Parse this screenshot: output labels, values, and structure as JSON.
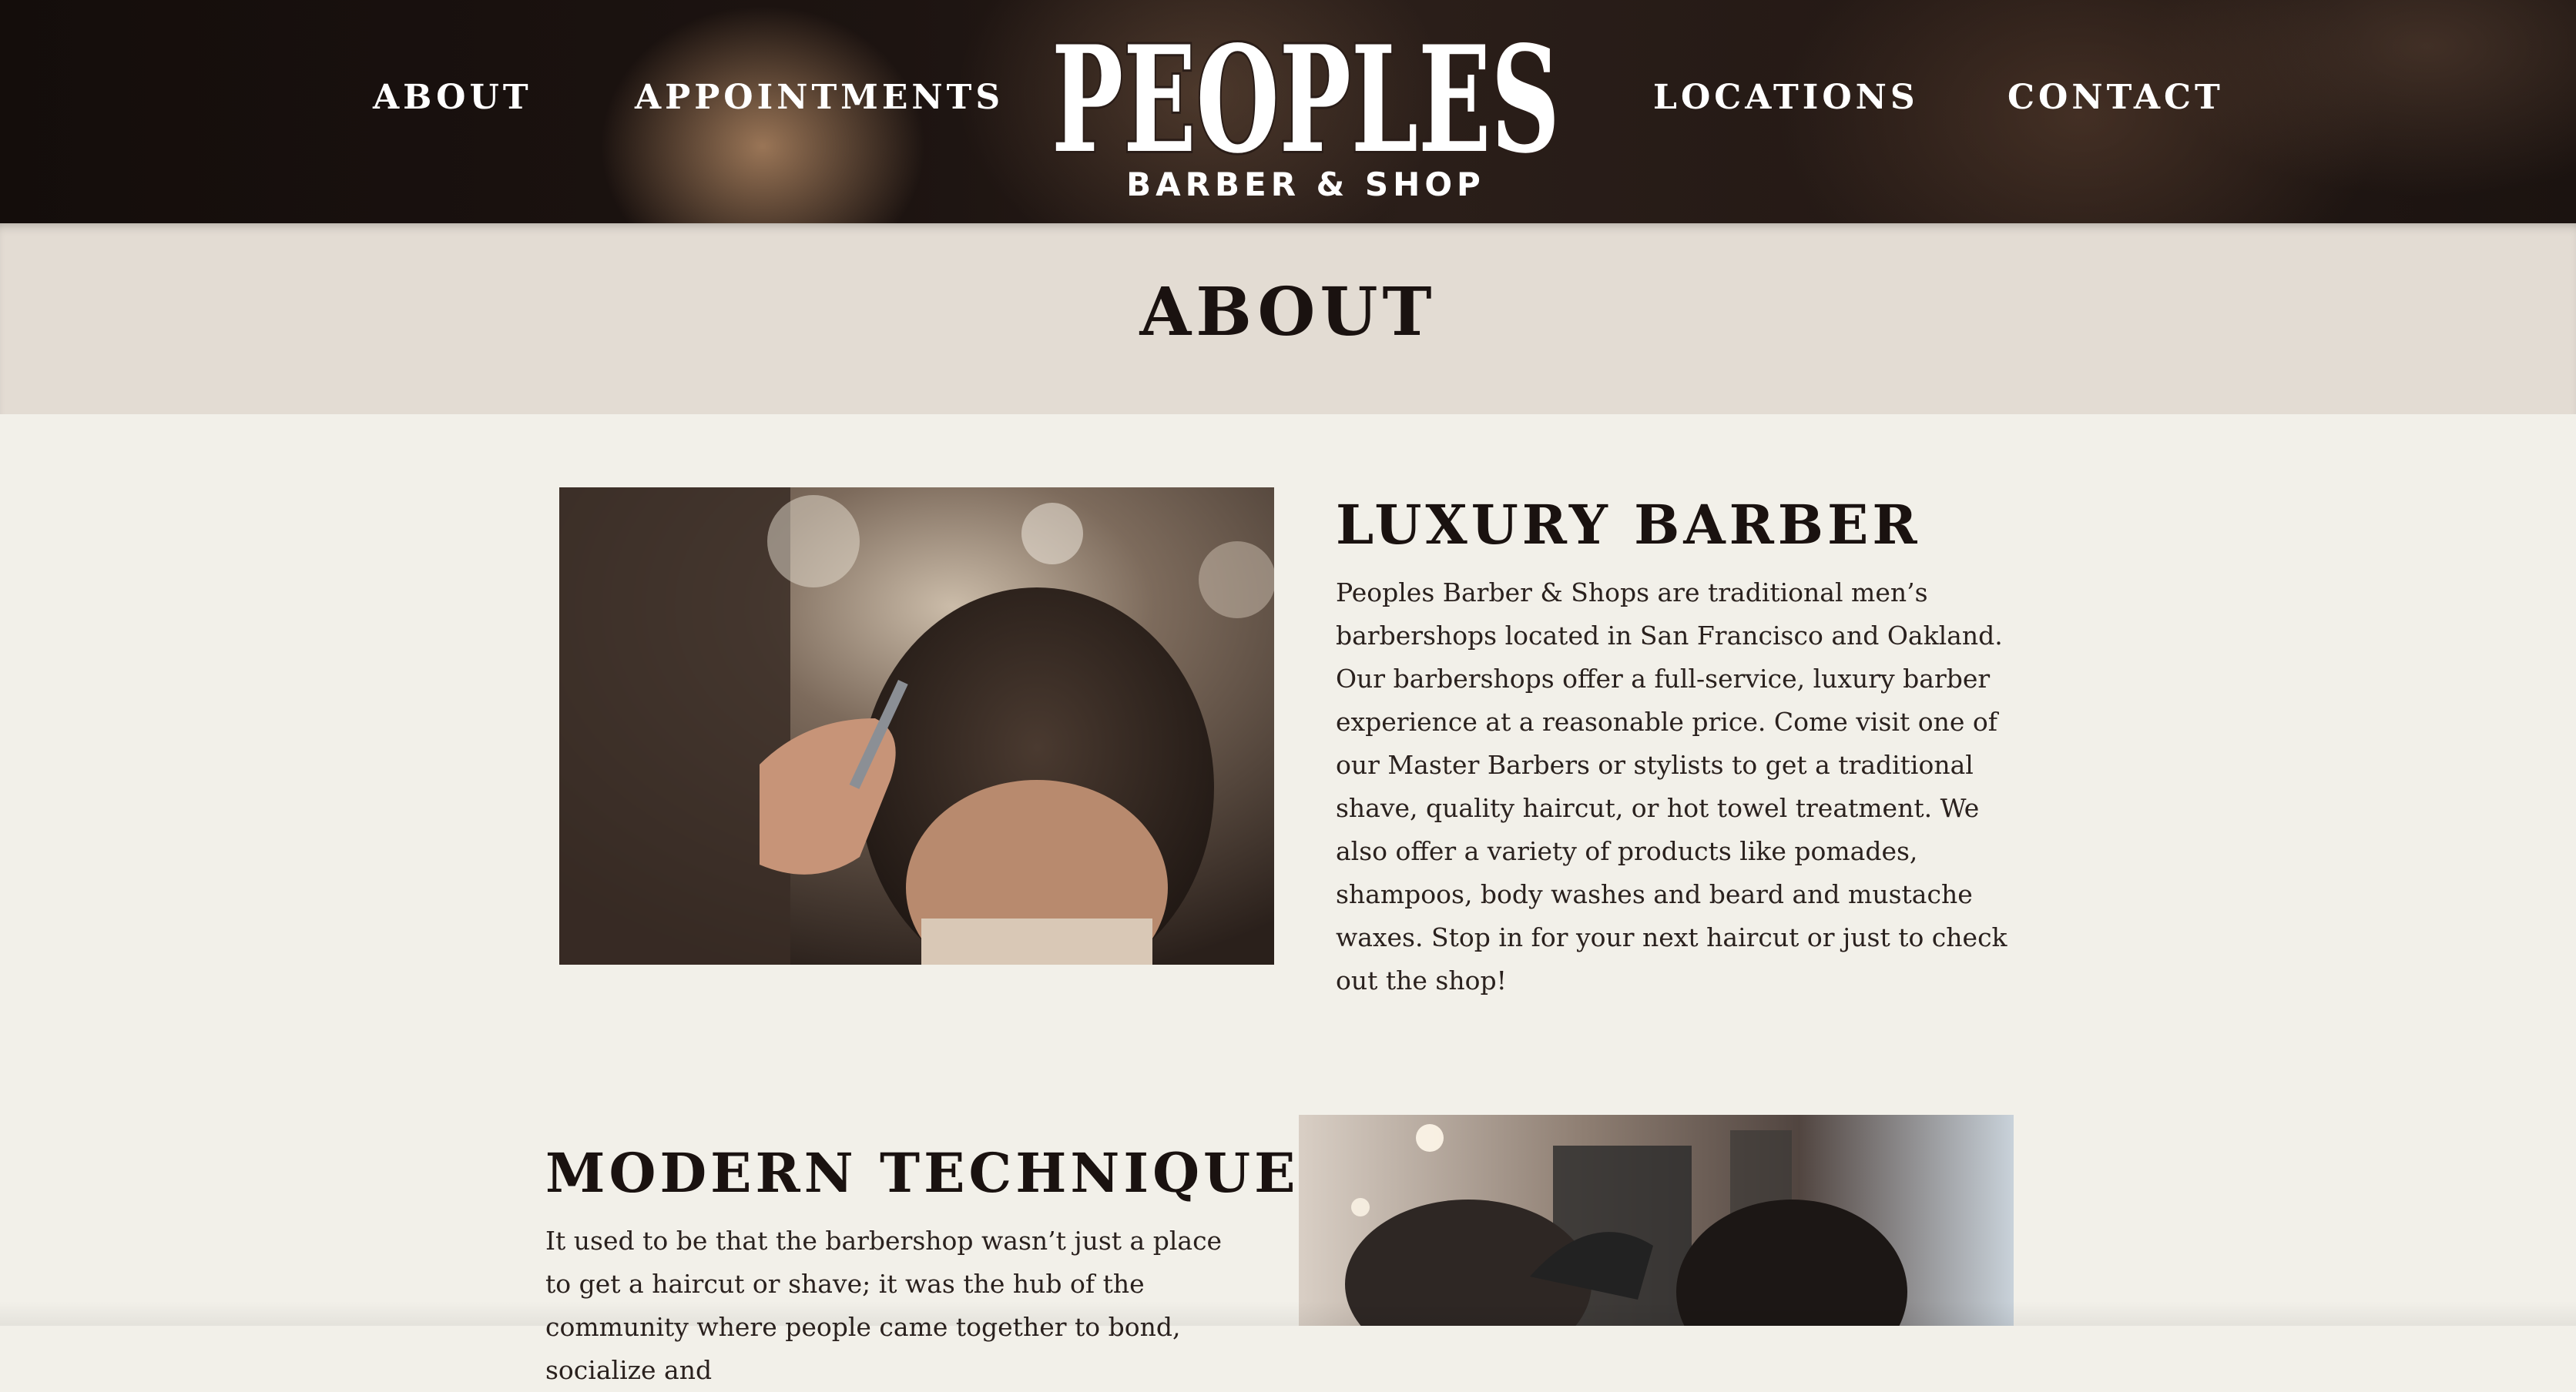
{
  "nav": {
    "items": [
      {
        "label": "ABOUT"
      },
      {
        "label": "APPOINTMENTS"
      },
      {
        "label": "LOCATIONS"
      },
      {
        "label": "CONTACT"
      }
    ]
  },
  "logo": {
    "wordmark": "PEOPLES",
    "tagline": "BARBER & SHOP"
  },
  "page": {
    "title": "ABOUT"
  },
  "sections": [
    {
      "heading": "LUXURY BARBER",
      "body": "Peoples Barber & Shops are traditional men’s barbershops located in San Francisco and Oakland. Our barbershops offer a full-service, luxury barber experience at a reasonable price. Come visit one of our Master Barbers or stylists to get a traditional shave, quality haircut, or hot towel treatment. We also offer a variety of products like pomades, shampoos, body washes and beard and mustache waxes. Stop in for your next haircut or just to check out the shop!"
    },
    {
      "heading": "MODERN TECHNIQUE",
      "body": "It used to be that the barbershop wasn’t just a place to get a haircut or shave; it was the hub of the community where people came together to bond, socialize and"
    }
  ],
  "colors": {
    "header_bg": "#1b1310",
    "title_band": "#e3dcd3",
    "page_bg": "#f2f0e9",
    "text": "#1a1210"
  }
}
